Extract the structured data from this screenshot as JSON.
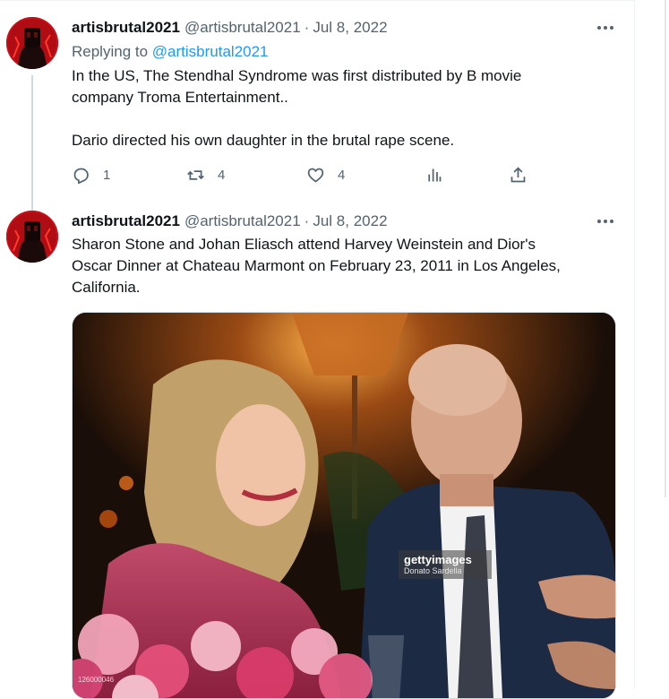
{
  "tweets": [
    {
      "author_name": "artisbrutal2021",
      "author_handle": "@artisbrutal2021",
      "separator": "·",
      "date": "Jul 8, 2022",
      "replying_prefix": "Replying to",
      "replying_to": "@artisbrutal2021",
      "body_line_1": "In the US, The Stendhal Syndrome was first distributed by B movie",
      "body_line_2": "company Troma Entertainment..",
      "body_line_3": "Dario directed his own daughter in the brutal rape scene.",
      "actions": {
        "reply_count": "1",
        "retweet_count": "4",
        "like_count": "4"
      }
    },
    {
      "author_name": "artisbrutal2021",
      "author_handle": "@artisbrutal2021",
      "separator": "·",
      "date": "Jul 8, 2022",
      "body_line_1": "Sharon Stone and Johan Eliasch attend Harvey Weinstein and Dior's",
      "body_line_2": "Oscar Dinner at Chateau Marmont on February 23, 2011 in Los Angeles,",
      "body_line_3": "California.",
      "media": {
        "watermark_brand": "gettyimages",
        "watermark_credit": "Donato Sardella",
        "image_id": "126000046"
      }
    }
  ],
  "colors": {
    "text_primary": "#0f1419",
    "text_secondary": "#536471",
    "link": "#1d9bf0",
    "divider": "#eff3f4",
    "avatar_red": "#d01016"
  },
  "icons": [
    "more-icon",
    "reply-icon",
    "retweet-icon",
    "like-icon",
    "views-icon",
    "share-icon"
  ]
}
